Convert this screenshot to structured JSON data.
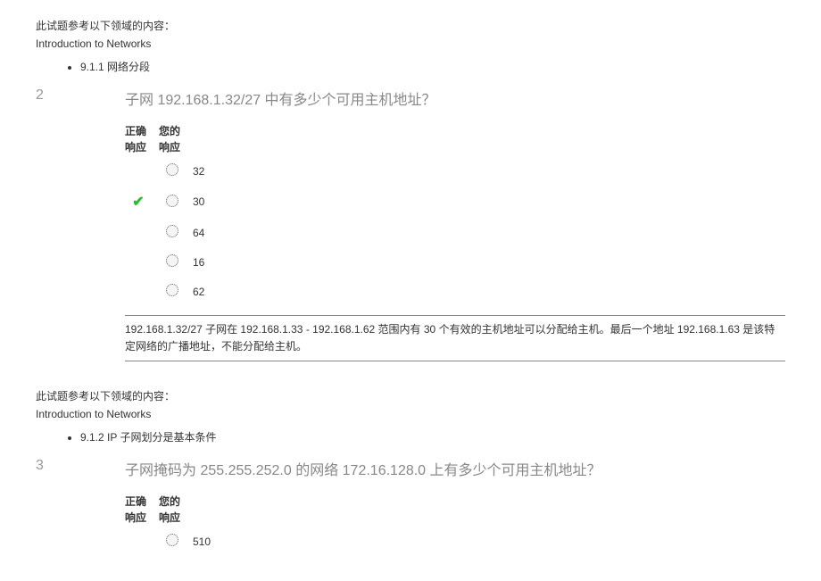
{
  "domain_intro": "此试题参考以下领域的内容：",
  "domain_name": "Introduction to Networks",
  "q2": {
    "number": "2",
    "domain_bullet": "9.1.1 网络分段",
    "text": "子网 192.168.1.32/27 中有多少个可用主机地址？",
    "header_correct_line1": "正确",
    "header_correct_line2": "响应",
    "header_your_line1": "您的",
    "header_your_line2": "响应",
    "options": [
      {
        "label": "32",
        "correct": false
      },
      {
        "label": "30",
        "correct": true
      },
      {
        "label": "64",
        "correct": false
      },
      {
        "label": "16",
        "correct": false
      },
      {
        "label": "62",
        "correct": false
      }
    ],
    "explanation": "192.168.1.32/27 子网在 192.168.1.33 - 192.168.1.62 范围内有 30 个有效的主机地址可以分配给主机。最后一个地址 192.168.1.63 是该特定网络的广播地址，不能分配给主机。"
  },
  "q3": {
    "number": "3",
    "domain_bullet": "9.1.2 IP 子网划分是基本条件",
    "text": "子网掩码为 255.255.252.0 的网络 172.16.128.0 上有多少个可用主机地址？",
    "header_correct_line1": "正确",
    "header_correct_line2": "响应",
    "header_your_line1": "您的",
    "header_your_line2": "响应",
    "options": [
      {
        "label": "510",
        "correct": false
      }
    ]
  }
}
